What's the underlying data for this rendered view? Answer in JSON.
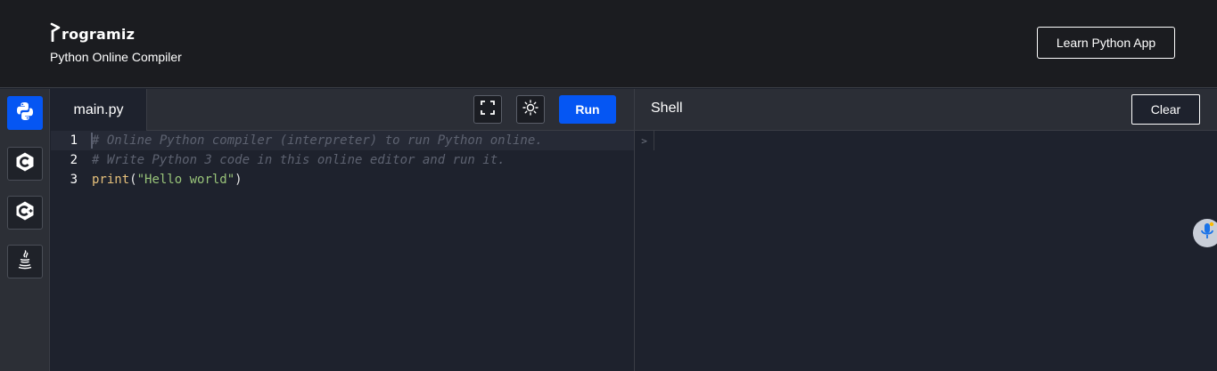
{
  "header": {
    "logo_text": "rogramiz",
    "subtitle": "Python Online Compiler",
    "learn_button": "Learn Python App"
  },
  "languages": [
    {
      "name": "python-icon",
      "active": true
    },
    {
      "name": "c-icon",
      "active": false
    },
    {
      "name": "cpp-icon",
      "active": false
    },
    {
      "name": "java-icon",
      "active": false
    }
  ],
  "editor": {
    "file_tab": "main.py",
    "run_label": "Run",
    "lines": [
      {
        "num": "1",
        "comment": "# Online Python compiler (interpreter) to run Python online."
      },
      {
        "num": "2",
        "comment": "# Write Python 3 code in this online editor and run it."
      },
      {
        "num": "3",
        "fn": "print",
        "open": "(",
        "str": "\"Hello world\"",
        "close": ")"
      }
    ]
  },
  "shell": {
    "title": "Shell",
    "clear_label": "Clear",
    "prompt": ">"
  },
  "colors": {
    "accent": "#0556f3",
    "header_bg": "#1b1c20",
    "panel_bg": "#1e222d",
    "comment": "#5d6270",
    "function": "#e5c07b",
    "string": "#98c379"
  }
}
